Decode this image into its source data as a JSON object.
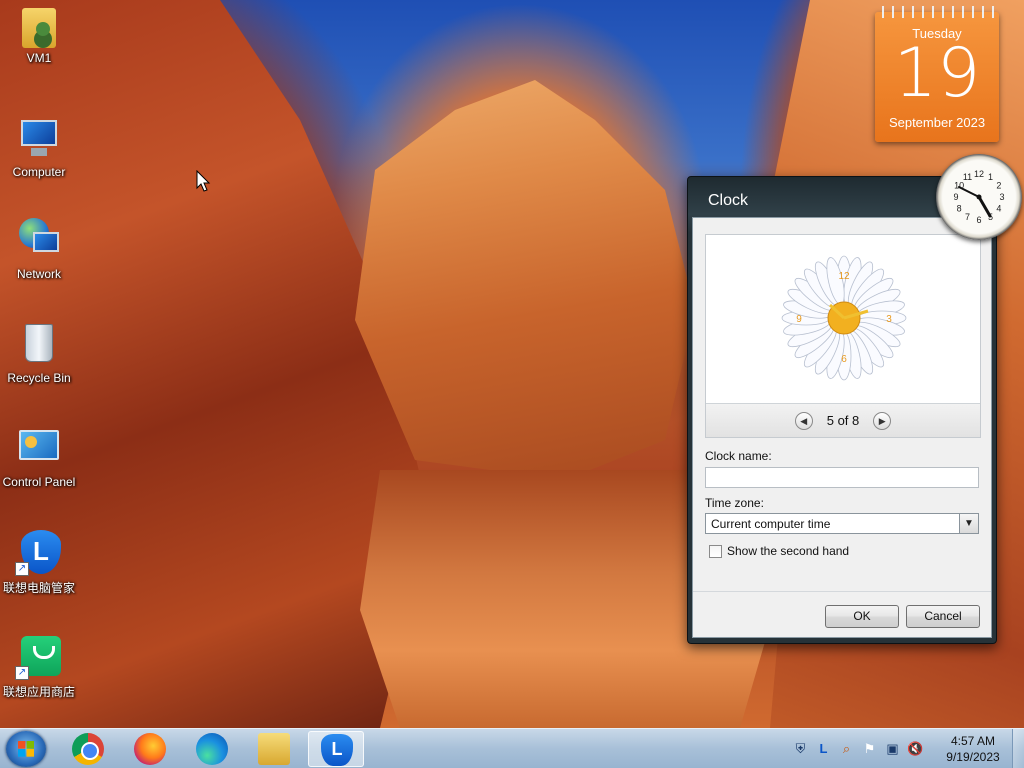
{
  "desktop": {
    "icons": [
      {
        "label": "VM1",
        "icon": "user-folder-icon"
      },
      {
        "label": "Computer",
        "icon": "computer-icon"
      },
      {
        "label": "Network",
        "icon": "network-icon"
      },
      {
        "label": "Recycle Bin",
        "icon": "recycle-bin-icon"
      },
      {
        "label": "Control Panel",
        "icon": "control-panel-icon"
      },
      {
        "label": "联想电脑管家",
        "icon": "lenovo-pc-manager-icon"
      },
      {
        "label": "联想应用商店",
        "icon": "lenovo-app-store-icon"
      }
    ]
  },
  "calendar_gadget": {
    "day_of_week": "Tuesday",
    "day": "19",
    "month_year": "September 2023"
  },
  "analog_clock_gadget": {
    "numerals": [
      "12",
      "1",
      "2",
      "3",
      "4",
      "5",
      "6",
      "7",
      "8",
      "9",
      "10",
      "11"
    ],
    "time": "4:57"
  },
  "clock_dialog": {
    "title": "Clock",
    "preview": {
      "style": "daisy",
      "numerals": [
        "12",
        "3",
        "6",
        "9"
      ],
      "pager": "5 of 8",
      "prev_icon": "prev-arrow-icon",
      "next_icon": "next-arrow-icon"
    },
    "clock_name_label": "Clock name:",
    "clock_name_value": "",
    "time_zone_label": "Time zone:",
    "time_zone_value": "Current computer time",
    "second_hand_label": "Show the second hand",
    "second_hand_checked": false,
    "ok_label": "OK",
    "cancel_label": "Cancel"
  },
  "taskbar": {
    "pinned": [
      {
        "name": "Google Chrome",
        "icon": "chrome-icon"
      },
      {
        "name": "Firefox",
        "icon": "firefox-icon"
      },
      {
        "name": "Microsoft Edge",
        "icon": "edge-icon"
      },
      {
        "name": "Windows Explorer",
        "icon": "explorer-icon"
      },
      {
        "name": "Lenovo PC Manager",
        "icon": "lenovo-icon",
        "active": true
      }
    ],
    "tray_icons": [
      "lenovo-shield-icon",
      "lenovo-l-icon",
      "search-icon",
      "flag-icon",
      "network-icon",
      "volume-muted-icon"
    ],
    "time": "4:57 AM",
    "date": "9/19/2023"
  },
  "colors": {
    "calendar_orange": "#f08a30",
    "dialog_frame": "#263238",
    "taskbar": "#a8c0d8"
  }
}
